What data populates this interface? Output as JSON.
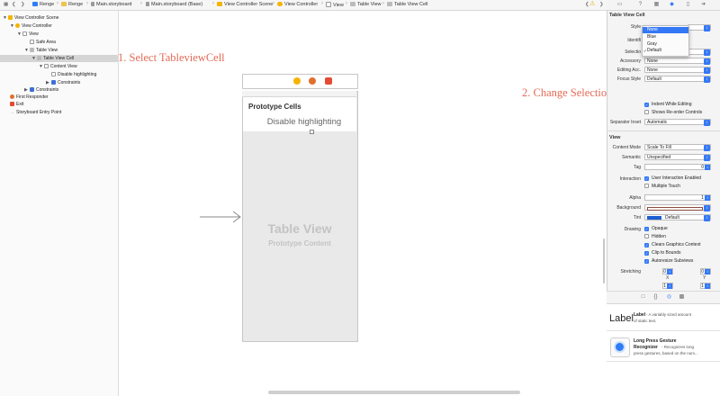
{
  "jumpbar": {
    "crumbs": [
      "Renge",
      "Renge",
      "Main.storyboard",
      "Main.storyboard (Base)",
      "View Controller Scene",
      "View Controller",
      "View",
      "Table View",
      "Table View Cell"
    ],
    "warning_count": "1"
  },
  "outline": {
    "items": [
      {
        "label": "View Controller Scene"
      },
      {
        "label": "View Controller"
      },
      {
        "label": "View"
      },
      {
        "label": "Safe Area"
      },
      {
        "label": "Table View"
      },
      {
        "label": "Table View Cell"
      },
      {
        "label": "Content View"
      },
      {
        "label": "Disable highlighting"
      },
      {
        "label": "Constraints"
      },
      {
        "label": "Constraints"
      },
      {
        "label": "First Responder"
      },
      {
        "label": "Exit"
      },
      {
        "label": "Storyboard Entry Point"
      }
    ]
  },
  "annotations": {
    "step1": "1. Select TableviewCell",
    "step2": "2. Change Selection Default to None"
  },
  "canvas": {
    "prototype_cells": "Prototype Cells",
    "cell_label": "Disable highlighting",
    "table_view": "Table View",
    "prototype_content": "Prototype Content"
  },
  "inspector": {
    "section_cell": "Table View Cell",
    "style_label": "Style",
    "identifier_label": "Identifi",
    "selection_label": "Selectio",
    "accessory_label": "Accessory",
    "accessory_value": "None",
    "editing_label": "Editing Acc.",
    "editing_value": "None",
    "focus_label": "Focus Style",
    "focus_value": "Default",
    "indent_editing": "Indent While Editing",
    "shows_reorder": "Shows Re-order Controls",
    "separator_label": "Separator Inset",
    "separator_value": "Automatic",
    "section_view": "View",
    "content_mode_label": "Content Mode",
    "content_mode_value": "Scale To Fill",
    "semantic_label": "Semantic",
    "semantic_value": "Unspecified",
    "tag_label": "Tag",
    "tag_value": "0",
    "interaction_label": "Interaction",
    "user_interaction": "User Interaction Enabled",
    "multiple_touch": "Multiple Touch",
    "alpha_label": "Alpha",
    "alpha_value": "1",
    "background_label": "Background",
    "tint_label": "Tint",
    "tint_value": "Default",
    "drawing_label": "Drawing",
    "opaque": "Opaque",
    "hidden": "Hidden",
    "clears_context": "Clears Graphics Context",
    "clip_bounds": "Clip to Bounds",
    "autoresize": "Autoresize Subviews",
    "stretching_label": "Stretching",
    "stretch_x": "0",
    "stretch_y": "0",
    "x_label": "X",
    "y_label": "Y",
    "stretch_w": "1",
    "stretch_h": "1"
  },
  "dropdown": {
    "options": [
      "None",
      "Blue",
      "Gray",
      "Default"
    ],
    "highlighted": "None",
    "checked": "Default"
  },
  "library": {
    "label_big": "Label",
    "label_title": "Label",
    "label_desc1": "- A variably sized amount",
    "label_desc2": "of static text.",
    "gesture_title1": "Long Press Gesture",
    "gesture_title2": "Recognizer",
    "gesture_desc1": "- Recognizes long",
    "gesture_desc2": "press gestures, based on the num..."
  },
  "colors": {
    "annotation": "#e36a56",
    "accent": "#3478f6",
    "scene_icon": "#f5b400"
  }
}
